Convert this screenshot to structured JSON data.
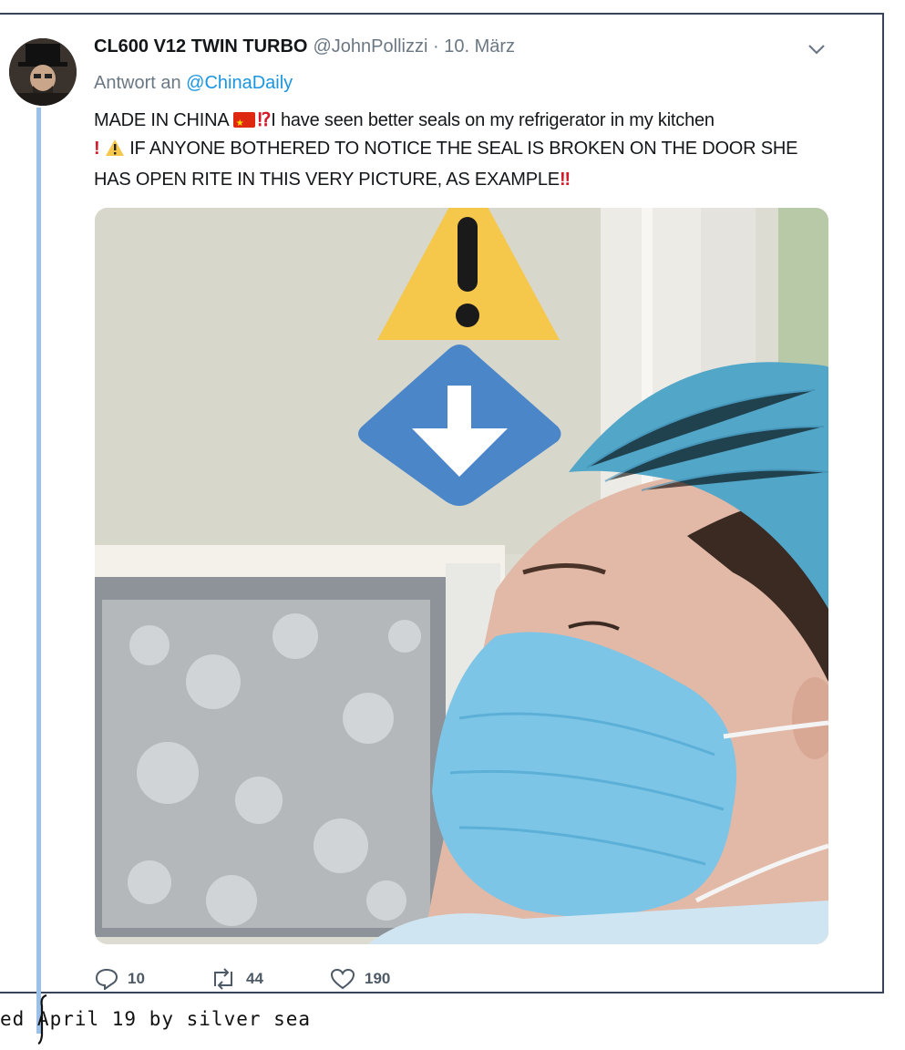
{
  "tweet": {
    "display_name": "CL600 V12 TWIN TURBO",
    "handle": "@JohnPollizzi",
    "separator": "·",
    "date": "10. März",
    "reply_prefix": "Antwort an",
    "reply_to": "@ChinaDaily",
    "text_part1": "MADE IN CHINA",
    "text_part2": "I have seen better seals on my refrigerator in my kitchen",
    "text_part3": "IF ANYONE BOTHERED TO NOTICE THE SEAL IS BROKEN ON THE DOOR SHE HAS OPEN RITE IN THIS VERY PICTURE, AS EXAMPLE",
    "emoji_exclaim_question": "⁉",
    "emoji_exclaim": "!",
    "emoji_double_exclaim": "‼"
  },
  "stats": {
    "replies": "10",
    "retweets": "44",
    "likes": "190"
  },
  "caption": {
    "text": "ed April 19 by silver sea"
  },
  "icons": [
    "chevron-down-icon",
    "reply-icon",
    "retweet-icon",
    "heart-icon",
    "warning-icon",
    "arrow-down-icon",
    "china-flag-icon"
  ],
  "colors": {
    "link": "#1b95e0",
    "thread_line": "#9cc1e8",
    "warning_yellow": "#f5c84c",
    "arrow_blue": "#4a86c8"
  }
}
